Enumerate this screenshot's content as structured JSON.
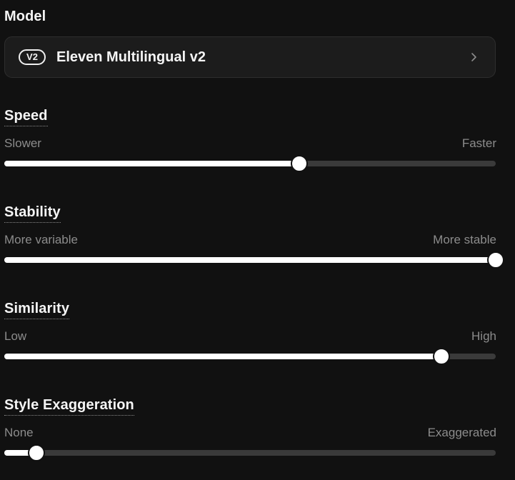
{
  "model": {
    "title": "Model",
    "badge": "V2",
    "name": "Eleven Multilingual v2",
    "chevron_icon": "chevron-right-icon"
  },
  "sliders": [
    {
      "id": "speed",
      "title": "Speed",
      "min_label": "Slower",
      "max_label": "Faster",
      "value": 0.6
    },
    {
      "id": "stability",
      "title": "Stability",
      "min_label": "More variable",
      "max_label": "More stable",
      "value": 1.0
    },
    {
      "id": "similarity",
      "title": "Similarity",
      "min_label": "Low",
      "max_label": "High",
      "value": 0.89
    },
    {
      "id": "style-exaggeration",
      "title": "Style Exaggeration",
      "min_label": "None",
      "max_label": "Exaggerated",
      "value": 0.065
    }
  ],
  "colors": {
    "background": "#111111",
    "track": "#3a3a3a",
    "fill": "#ffffff",
    "muted_text": "#8c8c8c"
  }
}
